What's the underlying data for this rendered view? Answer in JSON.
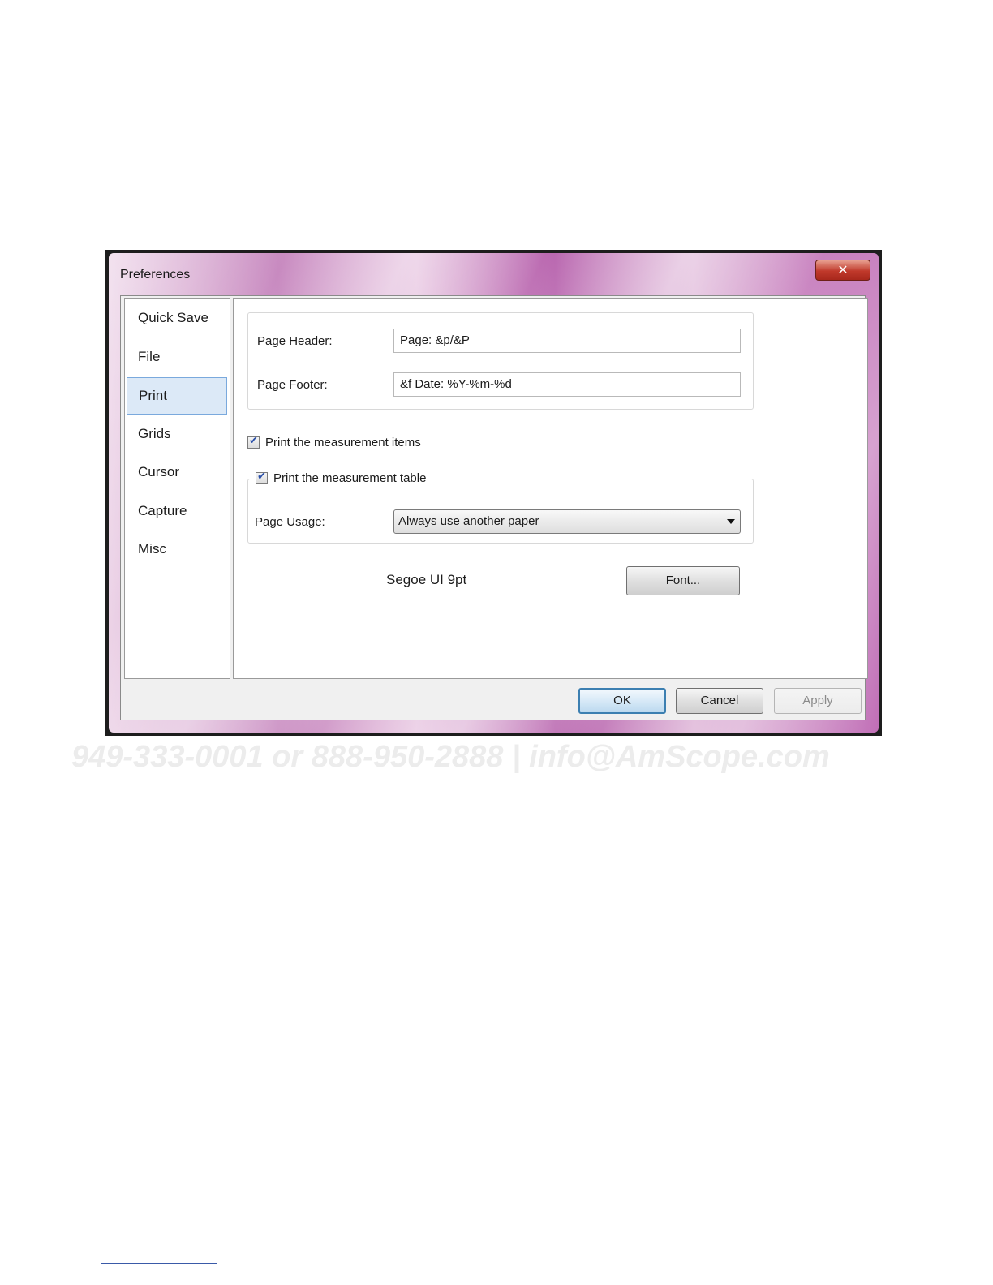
{
  "window": {
    "title": "Preferences",
    "close_glyph": "✕"
  },
  "nav": {
    "items": [
      {
        "label": "Quick Save",
        "selected": false
      },
      {
        "label": "File",
        "selected": false
      },
      {
        "label": "Print",
        "selected": true
      },
      {
        "label": "Grids",
        "selected": false
      },
      {
        "label": "Cursor",
        "selected": false
      },
      {
        "label": "Capture",
        "selected": false
      },
      {
        "label": "Misc",
        "selected": false
      }
    ]
  },
  "print": {
    "header_label": "Page Header:",
    "header_value": "Page: &p/&P",
    "footer_label": "Page Footer:",
    "footer_value": "&f Date: %Y-%m-%d",
    "measurement_items": {
      "label": "Print the measurement items",
      "checked": true
    },
    "measurement_table": {
      "label": "Print the measurement table",
      "checked": true
    },
    "page_usage_label": "Page Usage:",
    "page_usage_value": "Always use another paper",
    "font_display": "Segoe UI 9pt",
    "font_button": "Font..."
  },
  "buttons": {
    "ok": "OK",
    "cancel": "Cancel",
    "apply": "Apply"
  },
  "background": {
    "watermark_text": "949-333-0001 or 888-950-2888 | info@AmScope.com"
  },
  "icons": {
    "checkmark": "✔",
    "dropdown": "chevron-down-icon",
    "close": "close-icon"
  },
  "colors": {
    "selection": "#dce9f7",
    "selection_border": "#7aa9dd",
    "default_button_border": "#3c7fb1",
    "close_button": "#c0392b"
  }
}
